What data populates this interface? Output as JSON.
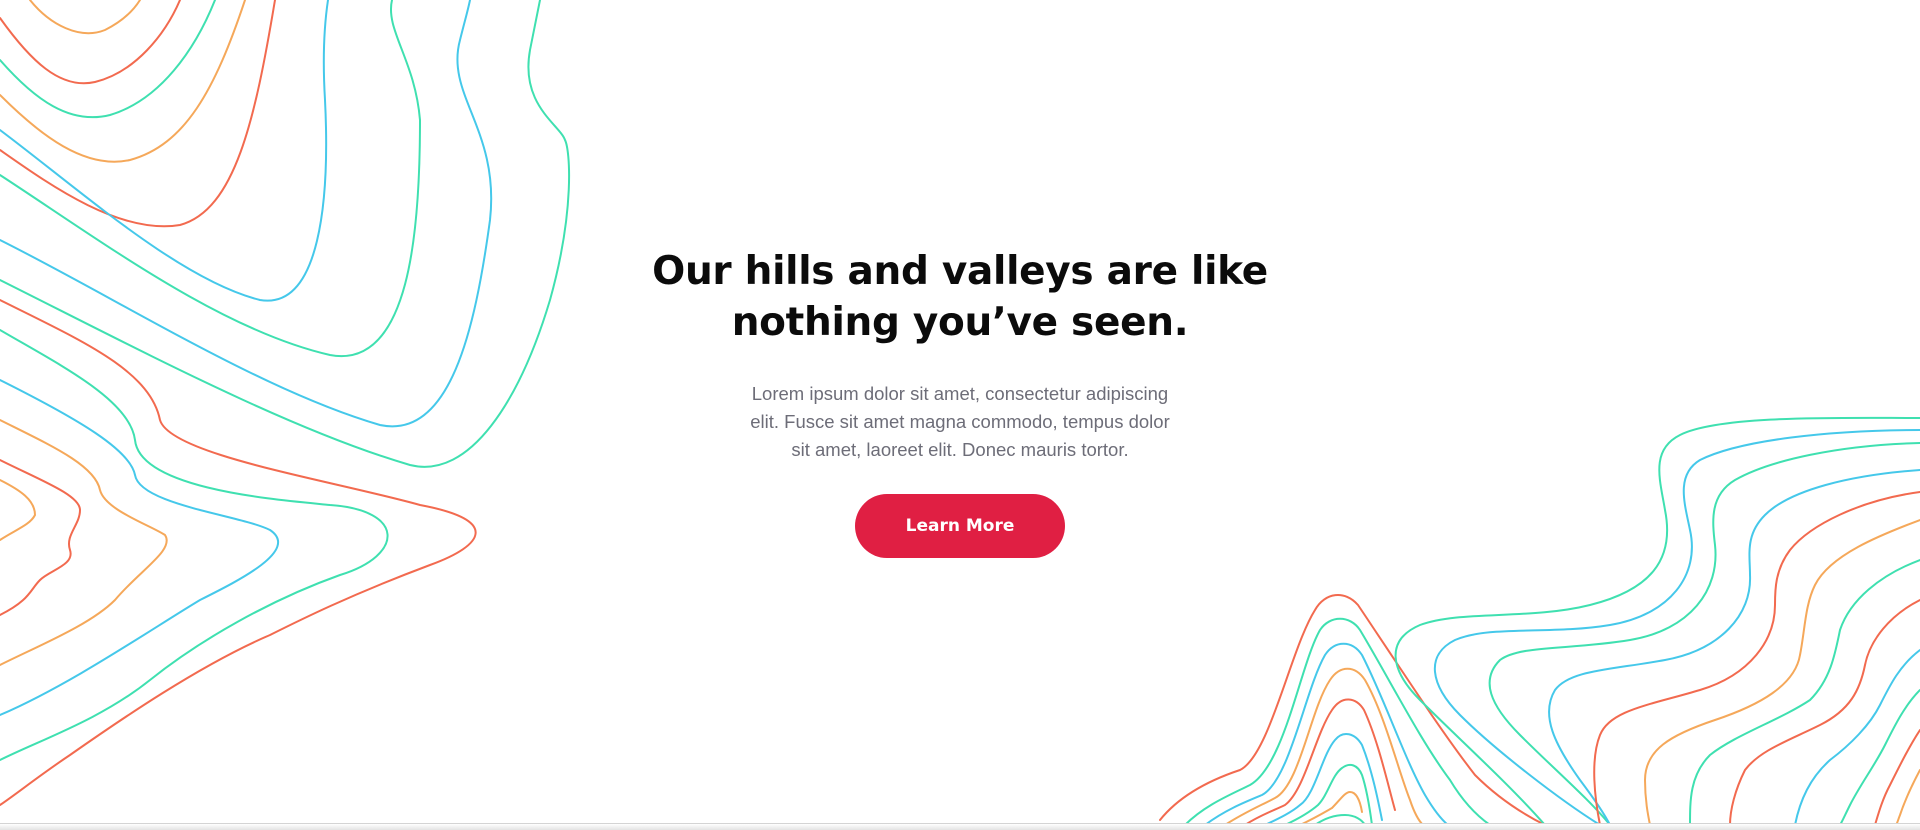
{
  "hero": {
    "title_lines": [
      "Our hills and valleys are like",
      "nothing you’ve seen."
    ],
    "body_lines": [
      "Lorem ipsum dolor sit amet, consectetur adipiscing",
      "elit. Fusce sit amet magna commodo, tempus dolor",
      "sit amet, laoreet elit. Donec mauris tortor."
    ],
    "cta_label": "Learn More"
  },
  "colors": {
    "accent": "#e01f43",
    "heading": "#0b0b0b",
    "body_text": "#6d6d78",
    "contour_red": "#f26a4f",
    "contour_orange": "#f5a85a",
    "contour_green": "#3fe0b0",
    "contour_blue": "#45c8ea"
  }
}
